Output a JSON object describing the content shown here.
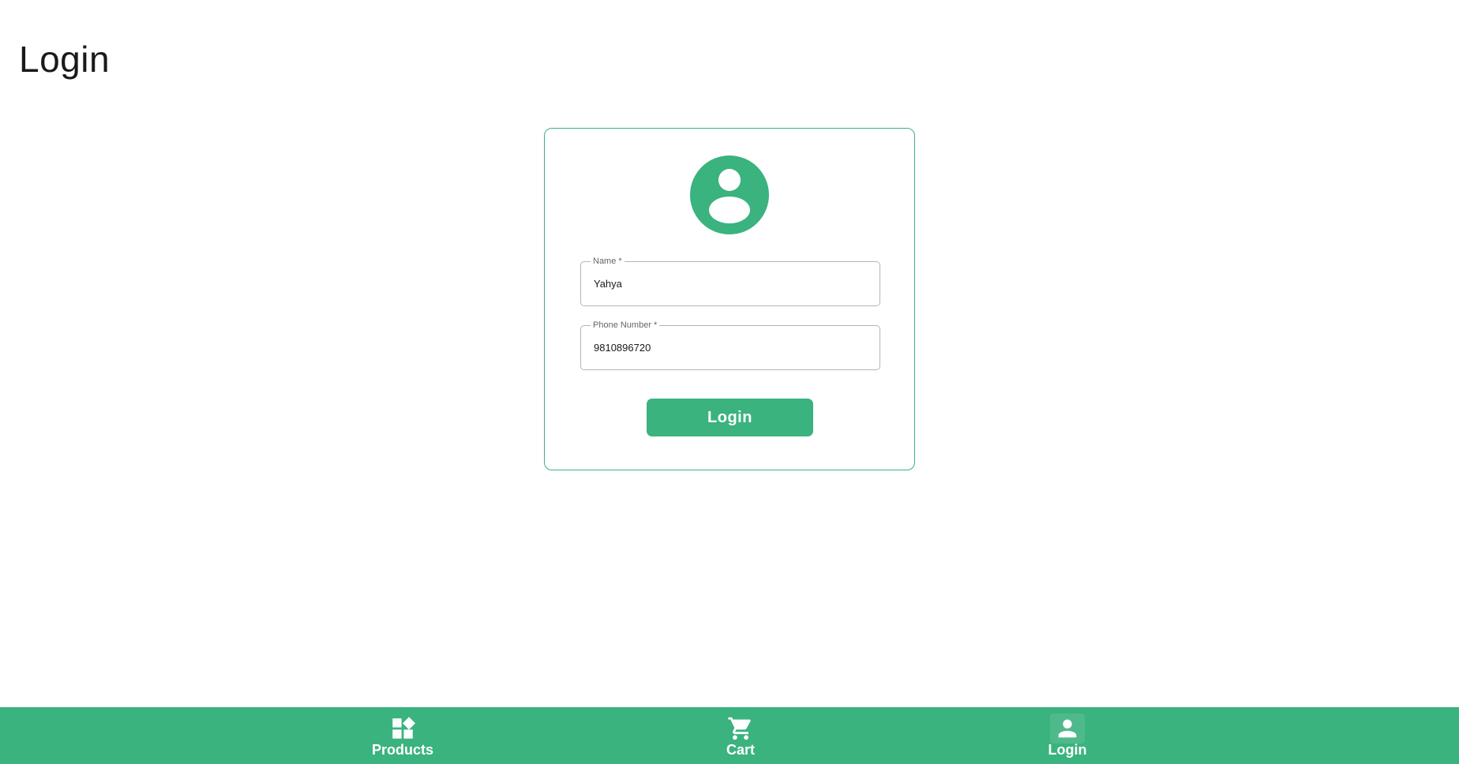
{
  "page": {
    "title": "Login"
  },
  "form": {
    "avatar_icon": "account-circle-icon",
    "name": {
      "label": "Name *",
      "value": "Yahya"
    },
    "phone": {
      "label": "Phone Number *",
      "value": "9810896720"
    },
    "submit_label": "Login"
  },
  "bottom_nav": {
    "items": [
      {
        "label": "Products",
        "icon": "widgets-icon"
      },
      {
        "label": "Cart",
        "icon": "cart-icon"
      },
      {
        "label": "Login",
        "icon": "person-icon",
        "active": true
      }
    ]
  },
  "colors": {
    "accent": "#3ab37f",
    "text": "#1a1a1a",
    "border": "#b5b5b5"
  }
}
